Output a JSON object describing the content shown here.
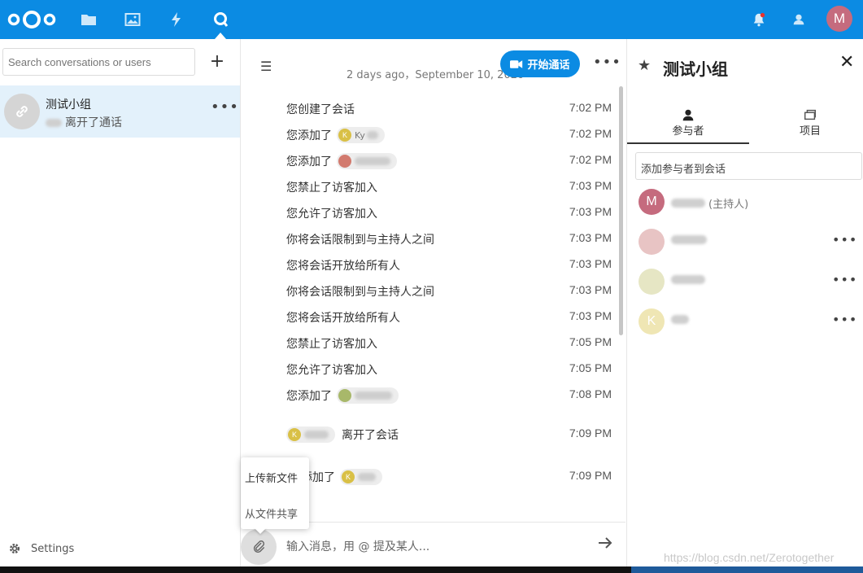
{
  "topbar": {
    "apps": [
      "files-icon",
      "photos-icon",
      "activity-icon",
      "talk-icon"
    ],
    "avatar_letter": "M",
    "accent": "#0b8be3"
  },
  "sidebar": {
    "search_placeholder": "Search conversations or users",
    "add_label": "+",
    "conversation": {
      "title": "测试小组",
      "subtitle": "离开了通话",
      "more": "•••"
    },
    "settings_label": "Settings"
  },
  "chat": {
    "date_separator": "2 days ago，September 10, 2020",
    "call_button": "开始通话",
    "more": "•••",
    "messages": [
      {
        "text": "您创建了会话",
        "time": "7:02 PM"
      },
      {
        "text": "您添加了",
        "chip_letter": "K",
        "chip_name": "Ky",
        "time": "7:02 PM"
      },
      {
        "text": "您添加了",
        "chip_letter": "",
        "chip_name": "",
        "time": "7:02 PM"
      },
      {
        "text": "您禁止了访客加入",
        "time": "7:03 PM"
      },
      {
        "text": "您允许了访客加入",
        "time": "7:03 PM"
      },
      {
        "text": "你将会话限制到与主持人之间",
        "time": "7:03 PM"
      },
      {
        "text": "您将会话开放给所有人",
        "time": "7:03 PM"
      },
      {
        "text": "你将会话限制到与主持人之间",
        "time": "7:03 PM"
      },
      {
        "text": "您将会话开放给所有人",
        "time": "7:03 PM"
      },
      {
        "text": "您禁止了访客加入",
        "time": "7:05 PM"
      },
      {
        "text": "您允许了访客加入",
        "time": "7:05 PM"
      },
      {
        "text": "您添加了",
        "chip_letter": "",
        "chip_name": "",
        "time": "7:08 PM"
      },
      {
        "text": "离开了会话",
        "chip_letter": "K",
        "chip_name": "",
        "time": "7:09 PM"
      },
      {
        "text": "添加了",
        "chip_letter": "K",
        "chip_name": "",
        "time": "7:09 PM"
      }
    ],
    "attach_menu": [
      "上传新文件",
      "从文件共享"
    ],
    "input_placeholder": "输入消息，用 @ 提及某人..."
  },
  "right_panel": {
    "title": "测试小组",
    "close": "✕",
    "tabs": [
      {
        "label": "参与者"
      },
      {
        "label": "项目"
      }
    ],
    "add_participant_placeholder": "添加参与者到会话",
    "participants": [
      {
        "letter": "M",
        "color": "#c56b7e",
        "role": "(主持人)"
      },
      {
        "letter": "",
        "color": "#e8c4c4",
        "role": ""
      },
      {
        "letter": "",
        "color": "#e6e6c4",
        "role": ""
      },
      {
        "letter": "K",
        "color": "#efe6b4",
        "role": ""
      }
    ]
  },
  "watermark": "https://blog.csdn.net/Zerotogether"
}
